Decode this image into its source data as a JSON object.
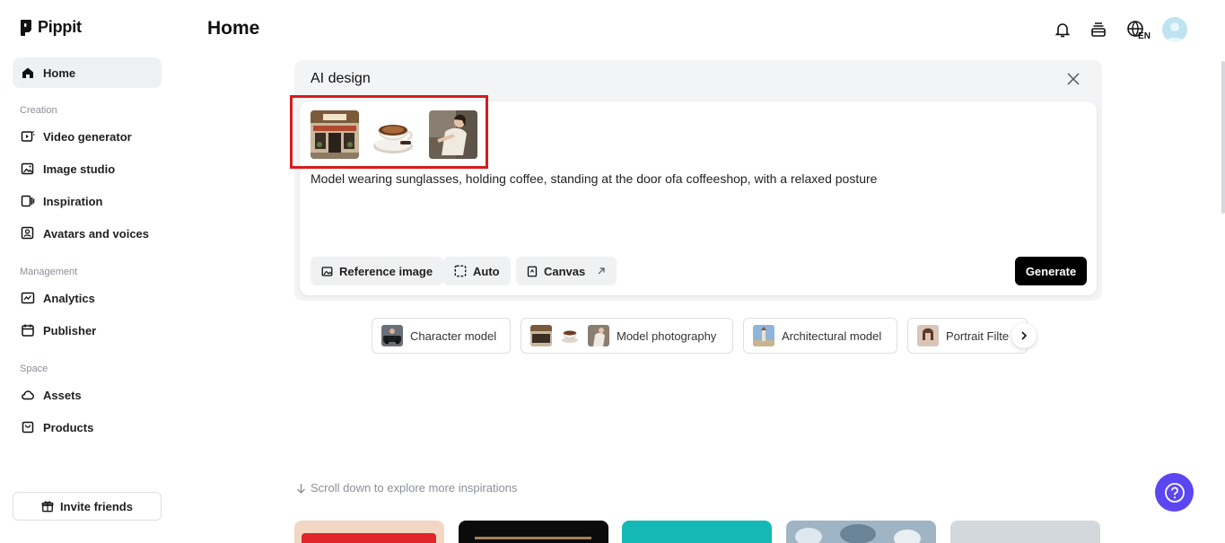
{
  "app": {
    "name": "Pippit"
  },
  "header": {
    "title": "Home",
    "language": "EN"
  },
  "sidebar": {
    "home": "Home",
    "section_creation": "Creation",
    "video_generator": "Video generator",
    "image_studio": "Image studio",
    "inspiration": "Inspiration",
    "avatars": "Avatars and voices",
    "section_management": "Management",
    "analytics": "Analytics",
    "publisher": "Publisher",
    "section_space": "Space",
    "assets": "Assets",
    "products": "Products",
    "invite": "Invite friends"
  },
  "ai_design": {
    "title": "AI design",
    "prompt": "Model wearing sunglasses, holding coffee, standing at the door ofa coffeeshop, with a relaxed posture",
    "reference_image": "Reference image",
    "auto": "Auto",
    "canvas": "Canvas",
    "generate": "Generate"
  },
  "suggestions": {
    "character_model": "Character model",
    "model_photography": "Model photography",
    "architectural_model": "Architectural model",
    "portrait_filter": "Portrait Filte"
  },
  "scroll_hint": "Scroll down to explore more inspirations",
  "colors": {
    "accent": "#5b46f1",
    "highlight": "#d81b1b",
    "generate_bg": "#000000"
  }
}
